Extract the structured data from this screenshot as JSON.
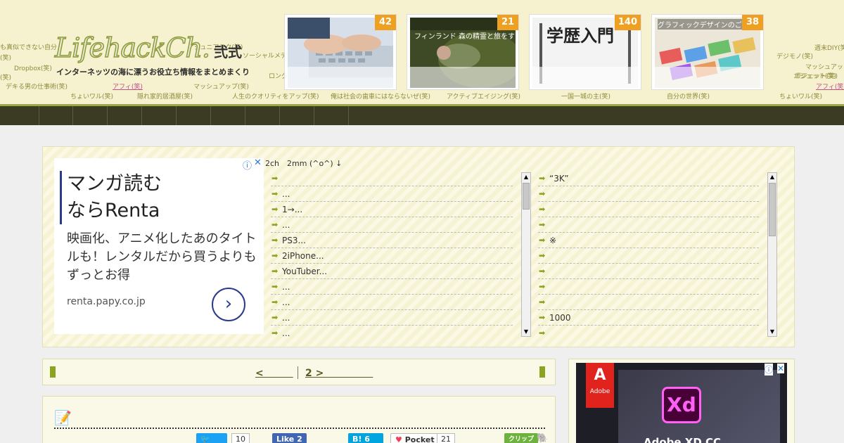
{
  "header": {
    "logo_main": "LifehackCh.",
    "logo_suffix": "弐式",
    "tagline": "インターネッツの海に漂うお役立ち情報をまとめまくり",
    "bg_words": [
      "(笑)",
      "Dropbox(笑)",
      "(笑)",
      "デキる男の仕事術(笑)",
      "ちょいワル(笑)",
      "アフィ(笑)",
      "隠れ家的居酒屋(笑)",
      "人生のクオリティをアップ(笑)",
      "俺は社会の歯車にはならないぜ(笑)",
      "アクティブエイジング(笑)",
      "一国一城の主(笑)",
      "自分の世界(笑)",
      "ちょいワル(笑)",
      "マッシュアップ(笑)",
      "ソーシャルメデ",
      "ロングテール",
      "ガジェット(笑)",
      "デジモノ(笑)",
      "週末DIY(笑)",
      "マッシュアップ",
      "ガジェット(笑)",
      "アフィ(笑)",
      "も真似できない自分",
      "ジュニアヌク(笑)"
    ],
    "thumbnails": [
      {
        "count": "42",
        "caption": ""
      },
      {
        "count": "21",
        "caption": "フィンランド 森の精霊と旅をする"
      },
      {
        "count": "140",
        "caption": "学歴入門"
      },
      {
        "count": "38",
        "caption": "グラフィックデザインのご用意"
      }
    ]
  },
  "ad": {
    "title_line1": "マンガ読む",
    "title_line2": "ならRenta",
    "body": "映画化、アニメ化したあのタイトルも！レンタルだから買うよりもずっとお得",
    "url": "renta.papy.co.jp",
    "go_symbol": "›",
    "info_icon": "ⓘ",
    "close_icon": "✕"
  },
  "ticker": "2ch　2mm (^o^) ↓",
  "list_left": [
    "",
    "...",
    "1→...",
    "...",
    "PS3...",
    "2iPhone...",
    "YouTuber...",
    "...",
    "...",
    "...",
    "..."
  ],
  "list_right": [
    "“3K”",
    "",
    "",
    "",
    "※",
    "",
    "",
    "",
    "",
    "1000",
    ""
  ],
  "pager": {
    "prev": "<　　　",
    "next": "2 >　　　　　"
  },
  "article": {
    "memo_icon": "📝",
    "share": {
      "twitter_count": "10",
      "like_label": "Like 2",
      "hatena_label": "B! 6",
      "pocket_label": "Pocket",
      "pocket_count": "21",
      "clip_label": "クリップ"
    }
  },
  "sidead": {
    "brand": "Adobe",
    "product": "Xd",
    "title": "Adobe XD CC"
  },
  "colors": {
    "accent": "#8ca320",
    "nav": "#3b3a22",
    "header_bg": "#f6f2cf",
    "badge": "#f0a020"
  }
}
